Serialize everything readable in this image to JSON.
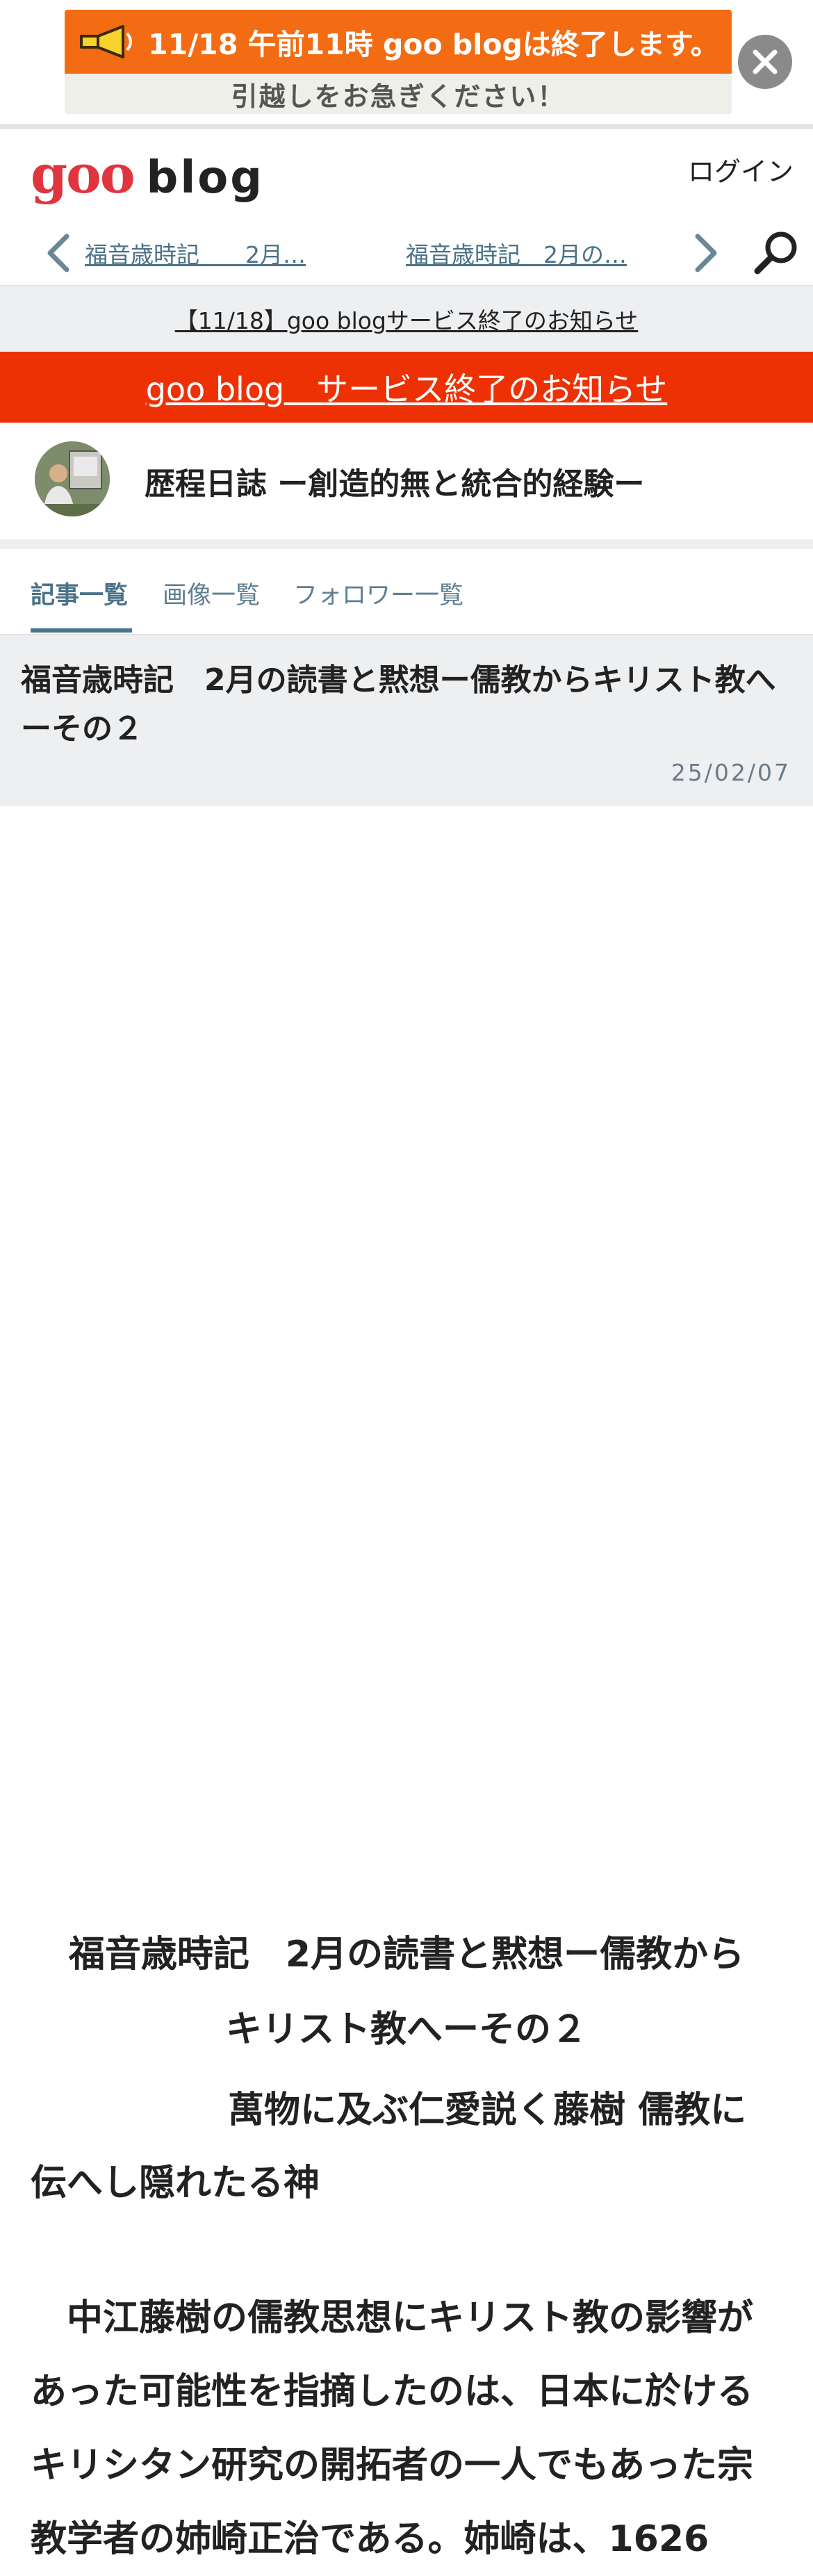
{
  "banner": {
    "line1": "11/18 午前11時 goo blogは終了します。",
    "line2": "引越しをお急ぎください！"
  },
  "header": {
    "logo_goo": "goo",
    "logo_blog": "blog",
    "login_label": "ログイン",
    "prev_article": "福音歳時記　　2月…",
    "next_article": "福音歳時記　2月の…"
  },
  "notices": {
    "gray_link": "【11/18】goo blogサービス終了のお知らせ",
    "red_link": "goo blog　サービス終了のお知らせ"
  },
  "blog": {
    "title": "歴程日誌 ー創造的無と統合的経験ー"
  },
  "tabs": [
    {
      "label": "記事一覧"
    },
    {
      "label": "画像一覧"
    },
    {
      "label": "フォロワー一覧"
    }
  ],
  "entry": {
    "title": "福音歳時記　2月の読書と黙想ー儒教からキリスト教へーその２",
    "date": "25/02/07"
  },
  "article": {
    "title_line1": "福音歳時記　2月の読書と黙想ー儒教から",
    "title_line2": "キリスト教へーその２",
    "haiku_line1": "萬物に及ぶ仁愛説く藤樹 儒教に",
    "haiku_line2": "伝へし隠れたる神",
    "paragraph": "　中江藤樹の儒教思想にキリスト教の影響があった可能性を指摘したのは、日本に於けるキリシタン研究の開拓者の一人でもあった宗教学者の姉崎正治である。姉崎は、1626"
  },
  "colors": {
    "banner_orange": "#f36b12",
    "notice_red": "#ee3105",
    "goo_red": "#e0343f",
    "link_blue": "#4a7288"
  }
}
